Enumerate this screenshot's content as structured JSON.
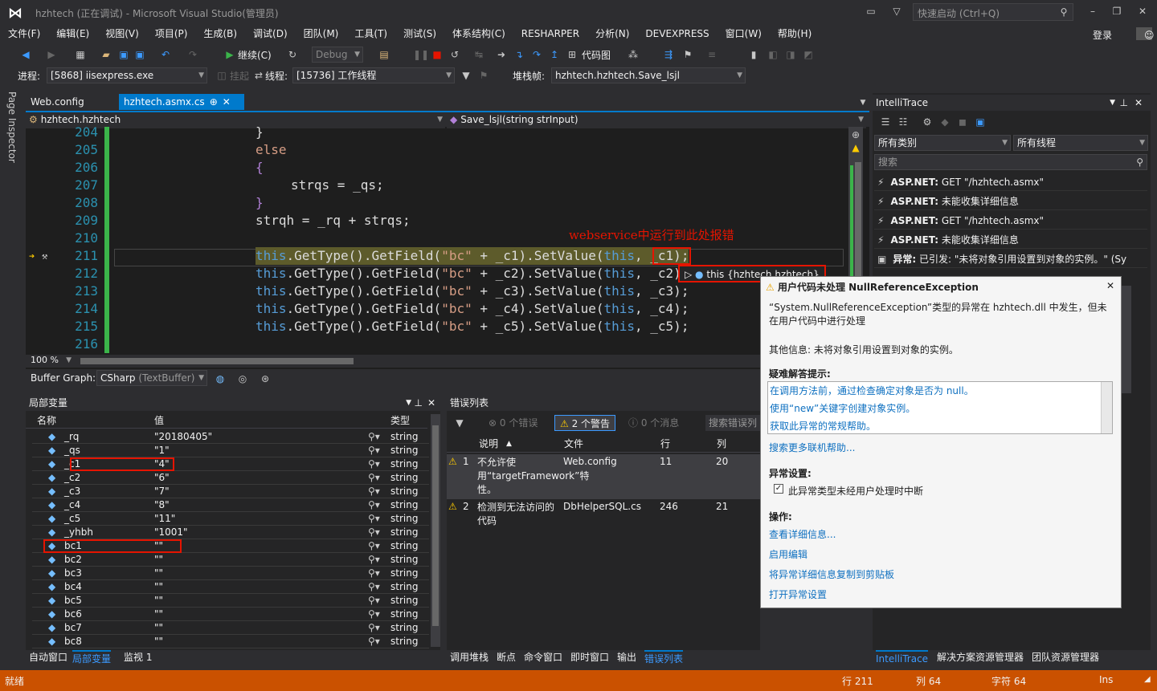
{
  "title": {
    "text": "hzhtech (正在调试) - Microsoft Visual Studio(管理员)",
    "quick_launch": "快速启动 (Ctrl+Q)",
    "login": "登录"
  },
  "menu": [
    "文件(F)",
    "编辑(E)",
    "视图(V)",
    "项目(P)",
    "生成(B)",
    "调试(D)",
    "团队(M)",
    "工具(T)",
    "测试(S)",
    "体系结构(C)",
    "RESHARPER",
    "分析(N)",
    "DEVEXPRESS",
    "窗口(W)",
    "帮助(H)"
  ],
  "toolbar": {
    "continue": "继续(C)",
    "config": "Debug",
    "codemap": "代码图"
  },
  "debugbar": {
    "process_label": "进程:",
    "process": "[5868] iisexpress.exe",
    "suspend": "挂起",
    "thread_label": "线程:",
    "thread": "[15736] 工作线程",
    "stack_label": "堆栈帧:",
    "stack": "hzhtech.hzhtech.Save_lsjl"
  },
  "side": {
    "page_inspector": "Page Inspector"
  },
  "editor": {
    "tabs": [
      "Web.config",
      "hzhtech.asmx.cs"
    ],
    "nav_left": "hzhtech.hzhtech",
    "nav_right": "Save_lsjl(string strInput)",
    "annotation": "webservice中运行到此处报错",
    "datatip": "this {hzhtech.hzhtech}",
    "zoom": "100 %",
    "lines": [
      204,
      205,
      206,
      207,
      208,
      209,
      210,
      211,
      212,
      213,
      214,
      215,
      216
    ]
  },
  "buffer": {
    "label": "Buffer Graph:",
    "value": "CSharp",
    "sub": "(TextBuffer)"
  },
  "locals": {
    "title": "局部变量",
    "cols": [
      "名称",
      "值",
      "类型"
    ],
    "rows": [
      {
        "name": "_rq",
        "value": "\"20180405\"",
        "type": "string"
      },
      {
        "name": "_qs",
        "value": "\"1\"",
        "type": "string"
      },
      {
        "name": "_c1",
        "value": "\"4\"",
        "type": "string"
      },
      {
        "name": "_c2",
        "value": "\"6\"",
        "type": "string"
      },
      {
        "name": "_c3",
        "value": "\"7\"",
        "type": "string"
      },
      {
        "name": "_c4",
        "value": "\"8\"",
        "type": "string"
      },
      {
        "name": "_c5",
        "value": "\"11\"",
        "type": "string"
      },
      {
        "name": "_yhbh",
        "value": "\"1001\"",
        "type": "string"
      },
      {
        "name": "bc1",
        "value": "\"\"",
        "type": "string"
      },
      {
        "name": "bc2",
        "value": "\"\"",
        "type": "string"
      },
      {
        "name": "bc3",
        "value": "\"\"",
        "type": "string"
      },
      {
        "name": "bc4",
        "value": "\"\"",
        "type": "string"
      },
      {
        "name": "bc5",
        "value": "\"\"",
        "type": "string"
      },
      {
        "name": "bc6",
        "value": "\"\"",
        "type": "string"
      },
      {
        "name": "bc7",
        "value": "\"\"",
        "type": "string"
      },
      {
        "name": "bc8",
        "value": "\"\"",
        "type": "string"
      }
    ],
    "bottom_tabs": [
      "自动窗口",
      "局部变量",
      "监视 1"
    ]
  },
  "errors": {
    "title": "错误列表",
    "errors_btn": "0 个错误",
    "warnings_btn": "2 个警告",
    "messages_btn": "0 个消息",
    "search": "搜索错误列",
    "cols": [
      "说明",
      "文件",
      "行",
      "列"
    ],
    "rows": [
      {
        "n": "1",
        "desc": "不允许使用“targetFramework”特性。",
        "file": "Web.config",
        "line": "11",
        "col": "20"
      },
      {
        "n": "2",
        "desc": "检测到无法访问的代码",
        "file": "DbHelperSQL.cs",
        "line": "246",
        "col": "21"
      }
    ],
    "bottom_tabs": [
      "调用堆栈",
      "断点",
      "命令窗口",
      "即时窗口",
      "输出",
      "错误列表"
    ]
  },
  "intellitrace": {
    "title": "IntelliTrace",
    "cat": "所有类别",
    "threads": "所有线程",
    "search": "搜索",
    "events": [
      {
        "bold": "ASP.NET:",
        "text": "GET \"/hzhtech.asmx\""
      },
      {
        "bold": "ASP.NET:",
        "text": "未能收集详细信息"
      },
      {
        "bold": "ASP.NET:",
        "text": "GET \"/hzhtech.asmx\""
      },
      {
        "bold": "ASP.NET:",
        "text": "未能收集详细信息"
      },
      {
        "bold": "异常:",
        "text": "已引发: \"未将对象引用设置到对象的实例。\" (Sy"
      }
    ],
    "bottom_tabs": [
      "IntelliTrace",
      "解决方案资源管理器",
      "团队资源管理器"
    ]
  },
  "exception": {
    "title": "用户代码未处理 NullReferenceException",
    "message": "“System.NullReferenceException”类型的异常在 hzhtech.dll 中发生，但未在用户代码中进行处理",
    "info": "其他信息: 未将对象引用设置到对象的实例。",
    "tips_title": "疑难解答提示:",
    "tips": [
      "在调用方法前，通过检查确定对象是否为 null。",
      "使用“new”关键字创建对象实例。",
      "获取此异常的常规帮助。"
    ],
    "more": "搜索更多联机帮助...",
    "settings_title": "异常设置:",
    "checkbox": "此异常类型未经用户处理时中断",
    "actions_title": "操作:",
    "actions": [
      "查看详细信息...",
      "启用编辑",
      "将异常详细信息复制到剪贴板",
      "打开异常设置"
    ]
  },
  "status": {
    "left": "就绪",
    "row": "行 211",
    "col": "列 64",
    "ch": "字符 64",
    "ins": "Ins"
  }
}
